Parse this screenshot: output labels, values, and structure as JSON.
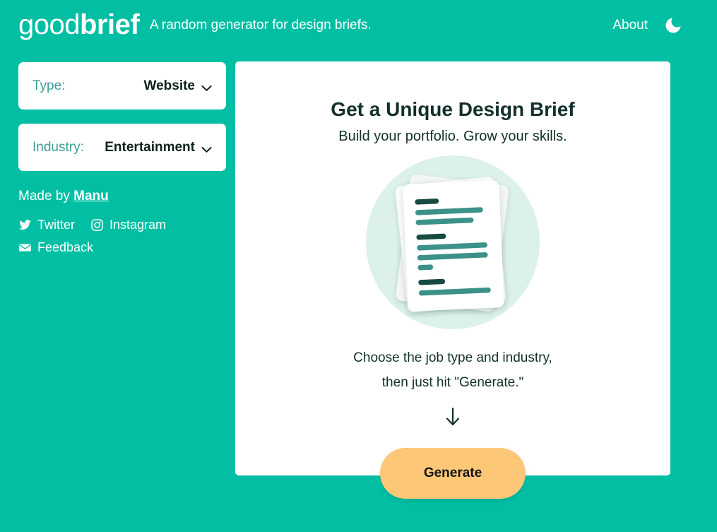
{
  "header": {
    "brand_light": "good",
    "brand_bold": "brief",
    "tagline": "A random generator for design briefs.",
    "about_label": "About",
    "theme_toggle_icon": "moon-icon"
  },
  "sidebar": {
    "selects": [
      {
        "label": "Type:",
        "value": "Website",
        "icon": "chevron-down-icon"
      },
      {
        "label": "Industry:",
        "value": "Entertainment",
        "icon": "chevron-down-icon"
      }
    ],
    "credits_prefix": "Made by ",
    "credits_author": "Manu",
    "social": [
      {
        "label": "Twitter",
        "icon": "twitter-icon"
      },
      {
        "label": "Instagram",
        "icon": "instagram-icon"
      },
      {
        "label": "Feedback",
        "icon": "envelope-icon"
      }
    ]
  },
  "card": {
    "title": "Get a Unique Design Brief",
    "subtitle": "Build your portfolio. Grow your skills.",
    "illustration_icon": "stacked-documents-icon",
    "instructions_line1": "Choose the job type and industry,",
    "instructions_line2": "then just hit \"Generate.\"",
    "arrow_icon": "arrow-down-icon",
    "generate_label": "Generate"
  },
  "colors": {
    "background_teal": "#02bfa4",
    "card_white": "#ffffff",
    "accent_peach": "#fcc878",
    "label_teal": "#3a9e95",
    "text_dark": "#13302b",
    "illustration_circle": "#ddf1ec",
    "illustration_bar_dark": "#124b43",
    "illustration_bar_mid": "#3a9289"
  }
}
